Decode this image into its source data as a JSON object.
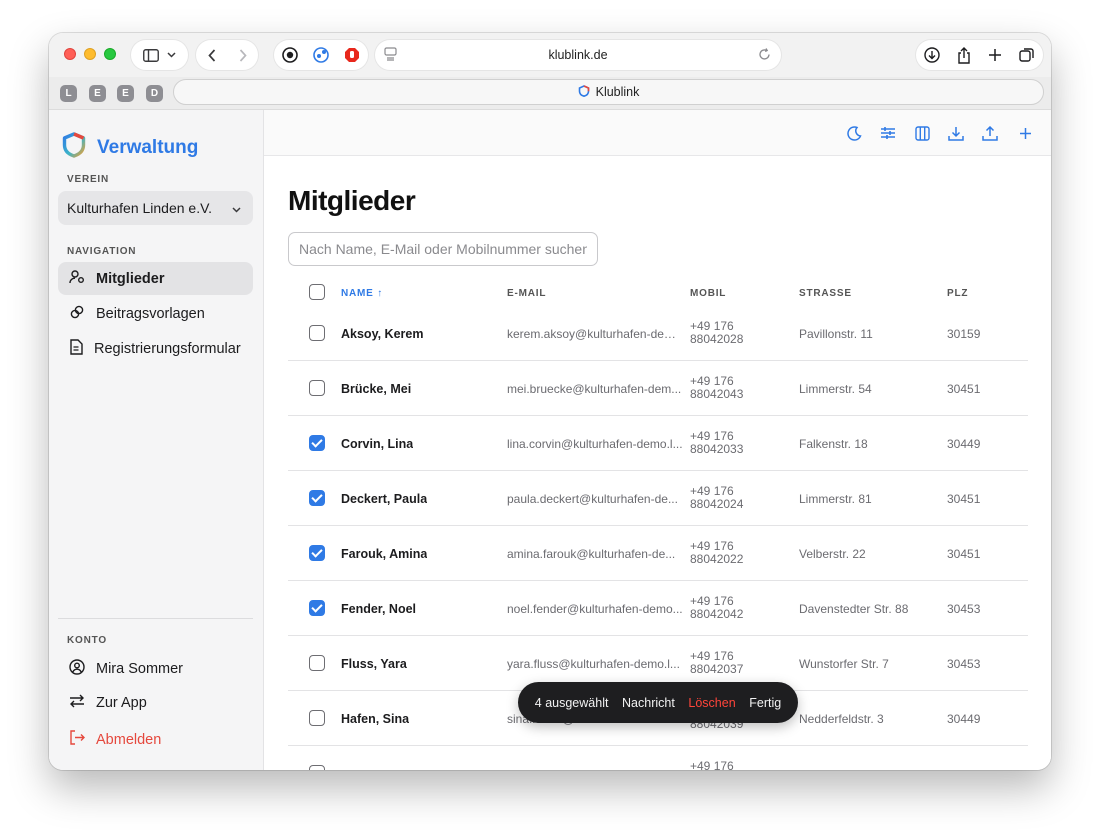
{
  "browser": {
    "url": "klublink.de",
    "tab_title": "Klublink",
    "tab_favicons": [
      "L",
      "E",
      "E",
      "D"
    ]
  },
  "sidebar": {
    "brand": "Verwaltung",
    "verein_label": "VEREIN",
    "club": "Kulturhafen Linden e.V.",
    "nav_label": "NAVIGATION",
    "nav": [
      {
        "label": "Mitglieder",
        "icon": "members-icon",
        "active": true
      },
      {
        "label": "Beitragsvorlagen",
        "icon": "link-icon",
        "active": false
      },
      {
        "label": "Registrierungsformular",
        "icon": "document-icon",
        "active": false
      }
    ],
    "account_label": "KONTO",
    "account": [
      {
        "label": "Mira Sommer",
        "icon": "user-circle-icon"
      },
      {
        "label": "Zur App",
        "icon": "switch-icon"
      },
      {
        "label": "Abmelden",
        "icon": "logout-icon",
        "color": "#e5483d"
      }
    ]
  },
  "main": {
    "title": "Mitglieder",
    "search_placeholder": "Nach Name, E-Mail oder Mobilnummer suchen",
    "columns": {
      "name": "NAME ↑",
      "email": "E-MAIL",
      "mobile": "MOBIL",
      "street": "STRASSE",
      "zip": "PLZ"
    },
    "rows": [
      {
        "name": "Aksoy, Kerem",
        "email": "kerem.aksoy@kulturhafen-dem...",
        "mobile_1": "+49 176",
        "mobile_2": "88042028",
        "street": "Pavillonstr. 11",
        "zip": "30159",
        "checked": false
      },
      {
        "name": "Brücke, Mei",
        "email": "mei.bruecke@kulturhafen-dem...",
        "mobile_1": "+49 176",
        "mobile_2": "88042043",
        "street": "Limmerstr. 54",
        "zip": "30451",
        "checked": false
      },
      {
        "name": "Corvin, Lina",
        "email": "lina.corvin@kulturhafen-demo.l...",
        "mobile_1": "+49 176",
        "mobile_2": "88042033",
        "street": "Falkenstr. 18",
        "zip": "30449",
        "checked": true
      },
      {
        "name": "Deckert, Paula",
        "email": "paula.deckert@kulturhafen-de...",
        "mobile_1": "+49 176",
        "mobile_2": "88042024",
        "street": "Limmerstr. 81",
        "zip": "30451",
        "checked": true
      },
      {
        "name": "Farouk, Amina",
        "email": "amina.farouk@kulturhafen-de...",
        "mobile_1": "+49 176",
        "mobile_2": "88042022",
        "street": "Velberstr. 22",
        "zip": "30451",
        "checked": true
      },
      {
        "name": "Fender, Noel",
        "email": "noel.fender@kulturhafen-demo...",
        "mobile_1": "+49 176",
        "mobile_2": "88042042",
        "street": "Davenstedter Str. 88",
        "zip": "30453",
        "checked": true
      },
      {
        "name": "Fluss, Yara",
        "email": "yara.fluss@kulturhafen-demo.l...",
        "mobile_1": "+49 176",
        "mobile_2": "88042037",
        "street": "Wunstorfer Str. 7",
        "zip": "30453",
        "checked": false
      },
      {
        "name": "Hafen, Sina",
        "email": "sina.hafen@kulturhafen-demo.l...",
        "mobile_1": "+49 176",
        "mobile_2": "88042039",
        "street": "Nedderfeldstr. 3",
        "zip": "30449",
        "checked": false
      },
      {
        "name": "",
        "email": "",
        "mobile_1": "+49 176",
        "mobile_2": "",
        "street": "",
        "zip": "",
        "checked": false
      }
    ]
  },
  "selection_bar": {
    "count": "4 ausgewählt",
    "message": "Nachricht",
    "delete": "Löschen",
    "done": "Fertig"
  },
  "colors": {
    "accent": "#2f7ae5",
    "danger": "#e5483d"
  }
}
